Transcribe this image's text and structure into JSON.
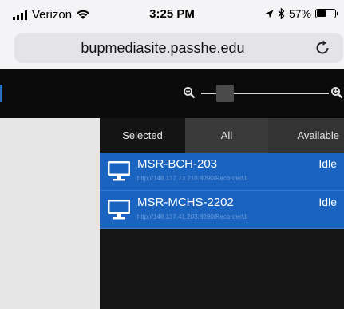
{
  "status_bar": {
    "carrier": "Verizon",
    "time": "3:25 PM",
    "battery": "57%",
    "battery_level": 0.57
  },
  "browser": {
    "url": "bupmediasite.passhe.edu"
  },
  "zoom": {
    "level": 0.15
  },
  "tabs": [
    {
      "label": "Selected"
    },
    {
      "label": "All"
    },
    {
      "label": "Available"
    }
  ],
  "recorders": [
    {
      "name": "MSR-BCH-203",
      "url": "http://148.137.73.210:8090/RecorderUI",
      "status": "Idle"
    },
    {
      "name": "MSR-MCHS-2202",
      "url": "http://148.137.41.203:8090/RecorderUI",
      "status": "Idle"
    }
  ],
  "colors": {
    "accent": "#1a63bf",
    "toolbar": "#0b0b0b"
  },
  "icons": [
    "wifi-icon",
    "location-arrow-icon",
    "bluetooth-icon",
    "battery-icon",
    "reload-icon",
    "zoom-out-icon",
    "zoom-in-icon",
    "monitor-icon"
  ]
}
